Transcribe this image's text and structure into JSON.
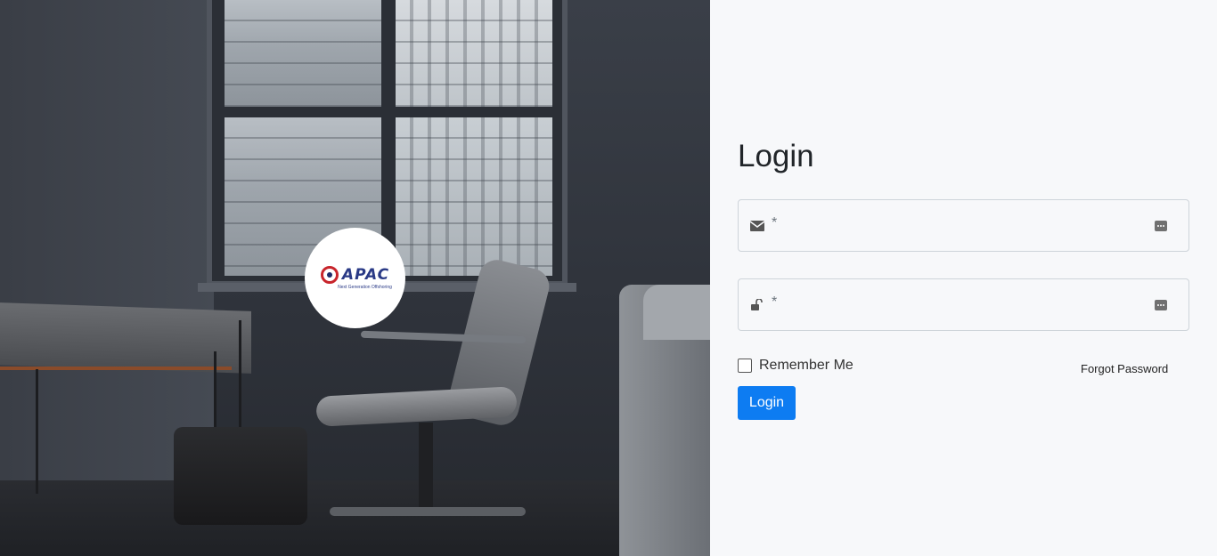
{
  "brand": {
    "logo_text": "APAC",
    "tagline": "Next Generation Offshoring"
  },
  "form": {
    "title": "Login",
    "email": {
      "required_marker": "*",
      "value": "",
      "icon": "envelope-icon",
      "addon_icon": "password-manager-icon"
    },
    "password": {
      "required_marker": "*",
      "value": "",
      "icon": "lock-open-icon",
      "addon_icon": "password-manager-icon"
    },
    "remember_label": "Remember Me",
    "remember_checked": false,
    "forgot_label": "Forgot Password",
    "submit_label": "Login"
  },
  "colors": {
    "primary_button": "#0d7cf2",
    "panel_background": "#f7f8fa",
    "input_border": "#ced4da"
  }
}
